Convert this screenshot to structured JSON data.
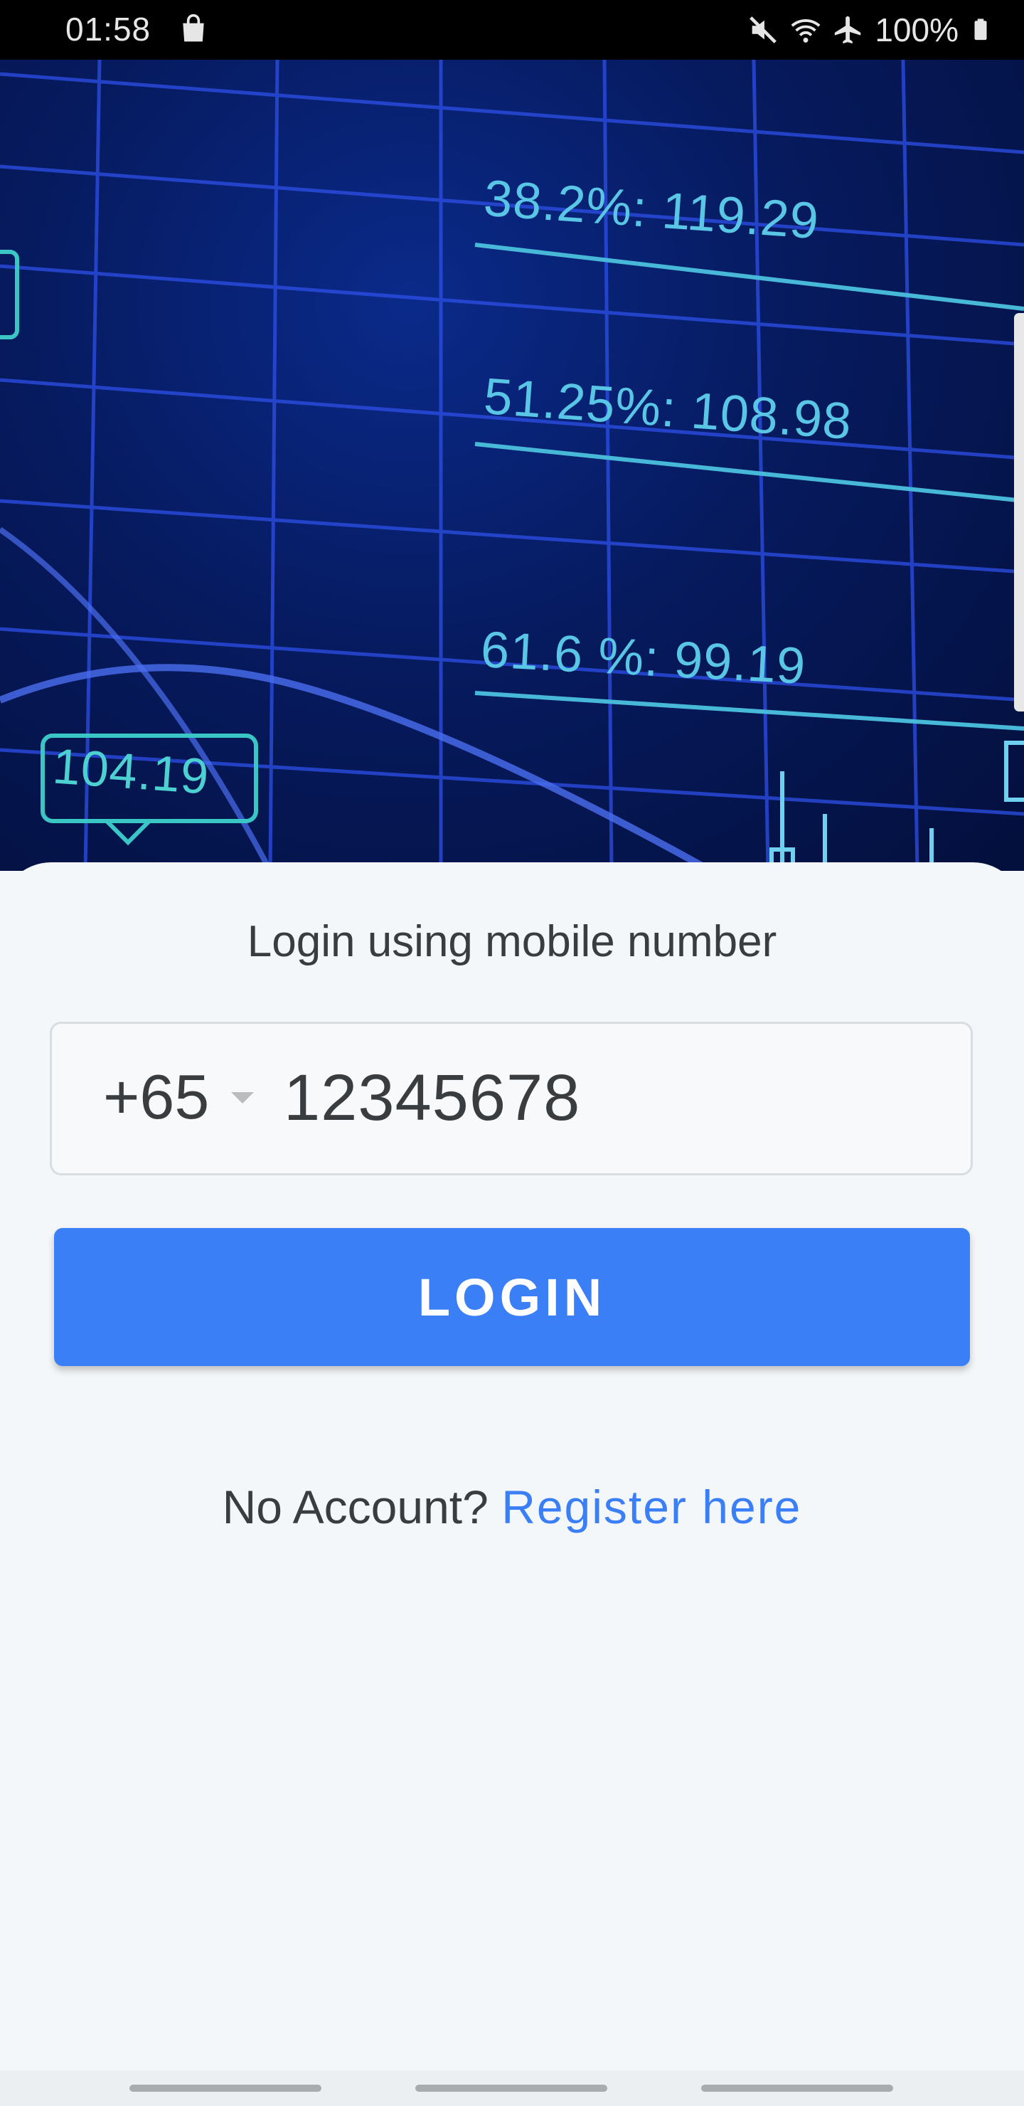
{
  "status_bar": {
    "time": "01:58",
    "battery_text": "100%",
    "icons": [
      "shopping-bag-icon",
      "mute-icon",
      "wifi-icon",
      "airplane-icon",
      "battery-icon"
    ]
  },
  "hero": {
    "labels": [
      "38.2%: 119.29",
      "51.25%: 108.98",
      "61.6 %:  99.19",
      "104.19"
    ]
  },
  "login": {
    "title": "Login using mobile number",
    "country_code": "+65",
    "phone_value": "12345678",
    "button_label": "LOGIN",
    "no_account_text": "No Account? ",
    "register_link": "Register here"
  },
  "colors": {
    "accent": "#3b7ff6",
    "text": "#3a3d40",
    "sheet_bg": "#f4f7f9"
  }
}
